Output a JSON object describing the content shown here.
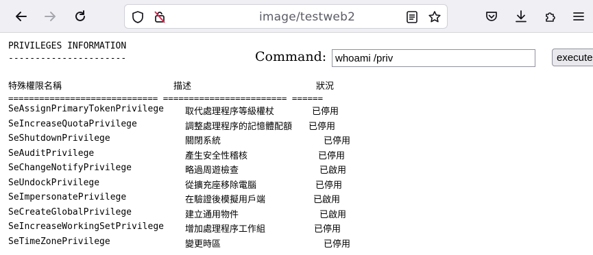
{
  "browser": {
    "url": "image/testweb2",
    "icons": [
      "back-icon",
      "forward-icon",
      "reload-icon",
      "shield-icon",
      "no-permission-icon",
      "reader-view-icon",
      "bookmark-star-icon",
      "pocket-icon",
      "download-icon",
      "extensions-icon",
      "menu-icon"
    ]
  },
  "page": {
    "heading": "PRIVILEGES INFORMATION",
    "heading_rule": "----------------------",
    "command_label": "Command:",
    "command_value": "whoami /priv",
    "execute_label": "execute",
    "columns": [
      "特殊權限名稱",
      "描述",
      "狀況"
    ],
    "separator": "============================= ======================== ======",
    "rows": [
      {
        "name": "SeAssignPrimaryTokenPrivilege",
        "desc": "取代處理程序等級權杖",
        "status": "已停用"
      },
      {
        "name": "SeIncreaseQuotaPrivilege",
        "desc": "調整處理程序的記憶體配額",
        "status": "已停用"
      },
      {
        "name": "SeShutdownPrivilege",
        "desc": "關閉系統",
        "status": "已停用"
      },
      {
        "name": "SeAuditPrivilege",
        "desc": "產生安全性稽核",
        "status": "已停用"
      },
      {
        "name": "SeChangeNotifyPrivilege",
        "desc": "略過周遊檢查",
        "status": "已啟用"
      },
      {
        "name": "SeUndockPrivilege",
        "desc": "從擴充座移除電腦",
        "status": "已停用"
      },
      {
        "name": "SeImpersonatePrivilege",
        "desc": "在驗證後模擬用戶端",
        "status": "已啟用"
      },
      {
        "name": "SeCreateGlobalPrivilege",
        "desc": "建立通用物件",
        "status": "已啟用"
      },
      {
        "name": "SeIncreaseWorkingSetPrivilege",
        "desc": "增加處理程序工作組",
        "status": "已停用"
      },
      {
        "name": "SeTimeZonePrivilege",
        "desc": "變更時區",
        "status": "已停用"
      }
    ]
  }
}
